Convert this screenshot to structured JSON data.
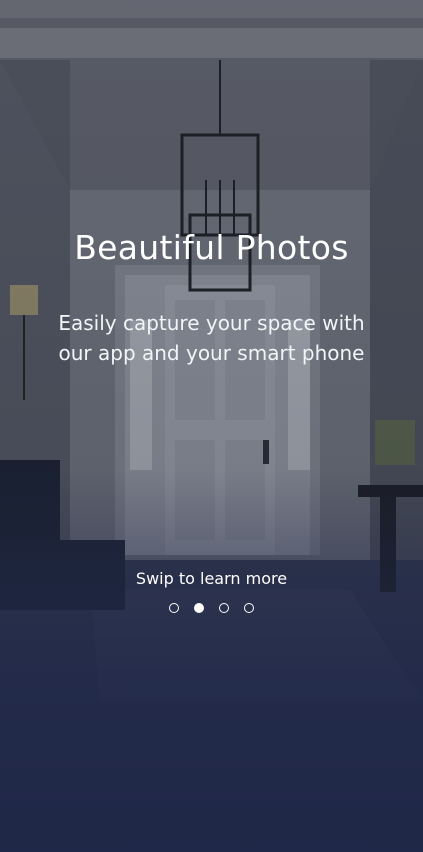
{
  "onboarding": {
    "title": "Beautiful Photos",
    "subtitle": "Easily capture your space with our app and your smart phone",
    "hint": "Swip to learn more",
    "pager": {
      "total": 4,
      "active_index": 1
    }
  },
  "colors": {
    "background_bottom": "#1f2748",
    "text": "#ffffff",
    "dot": "#ffffff"
  },
  "background_image": "entryway-interior-photo"
}
